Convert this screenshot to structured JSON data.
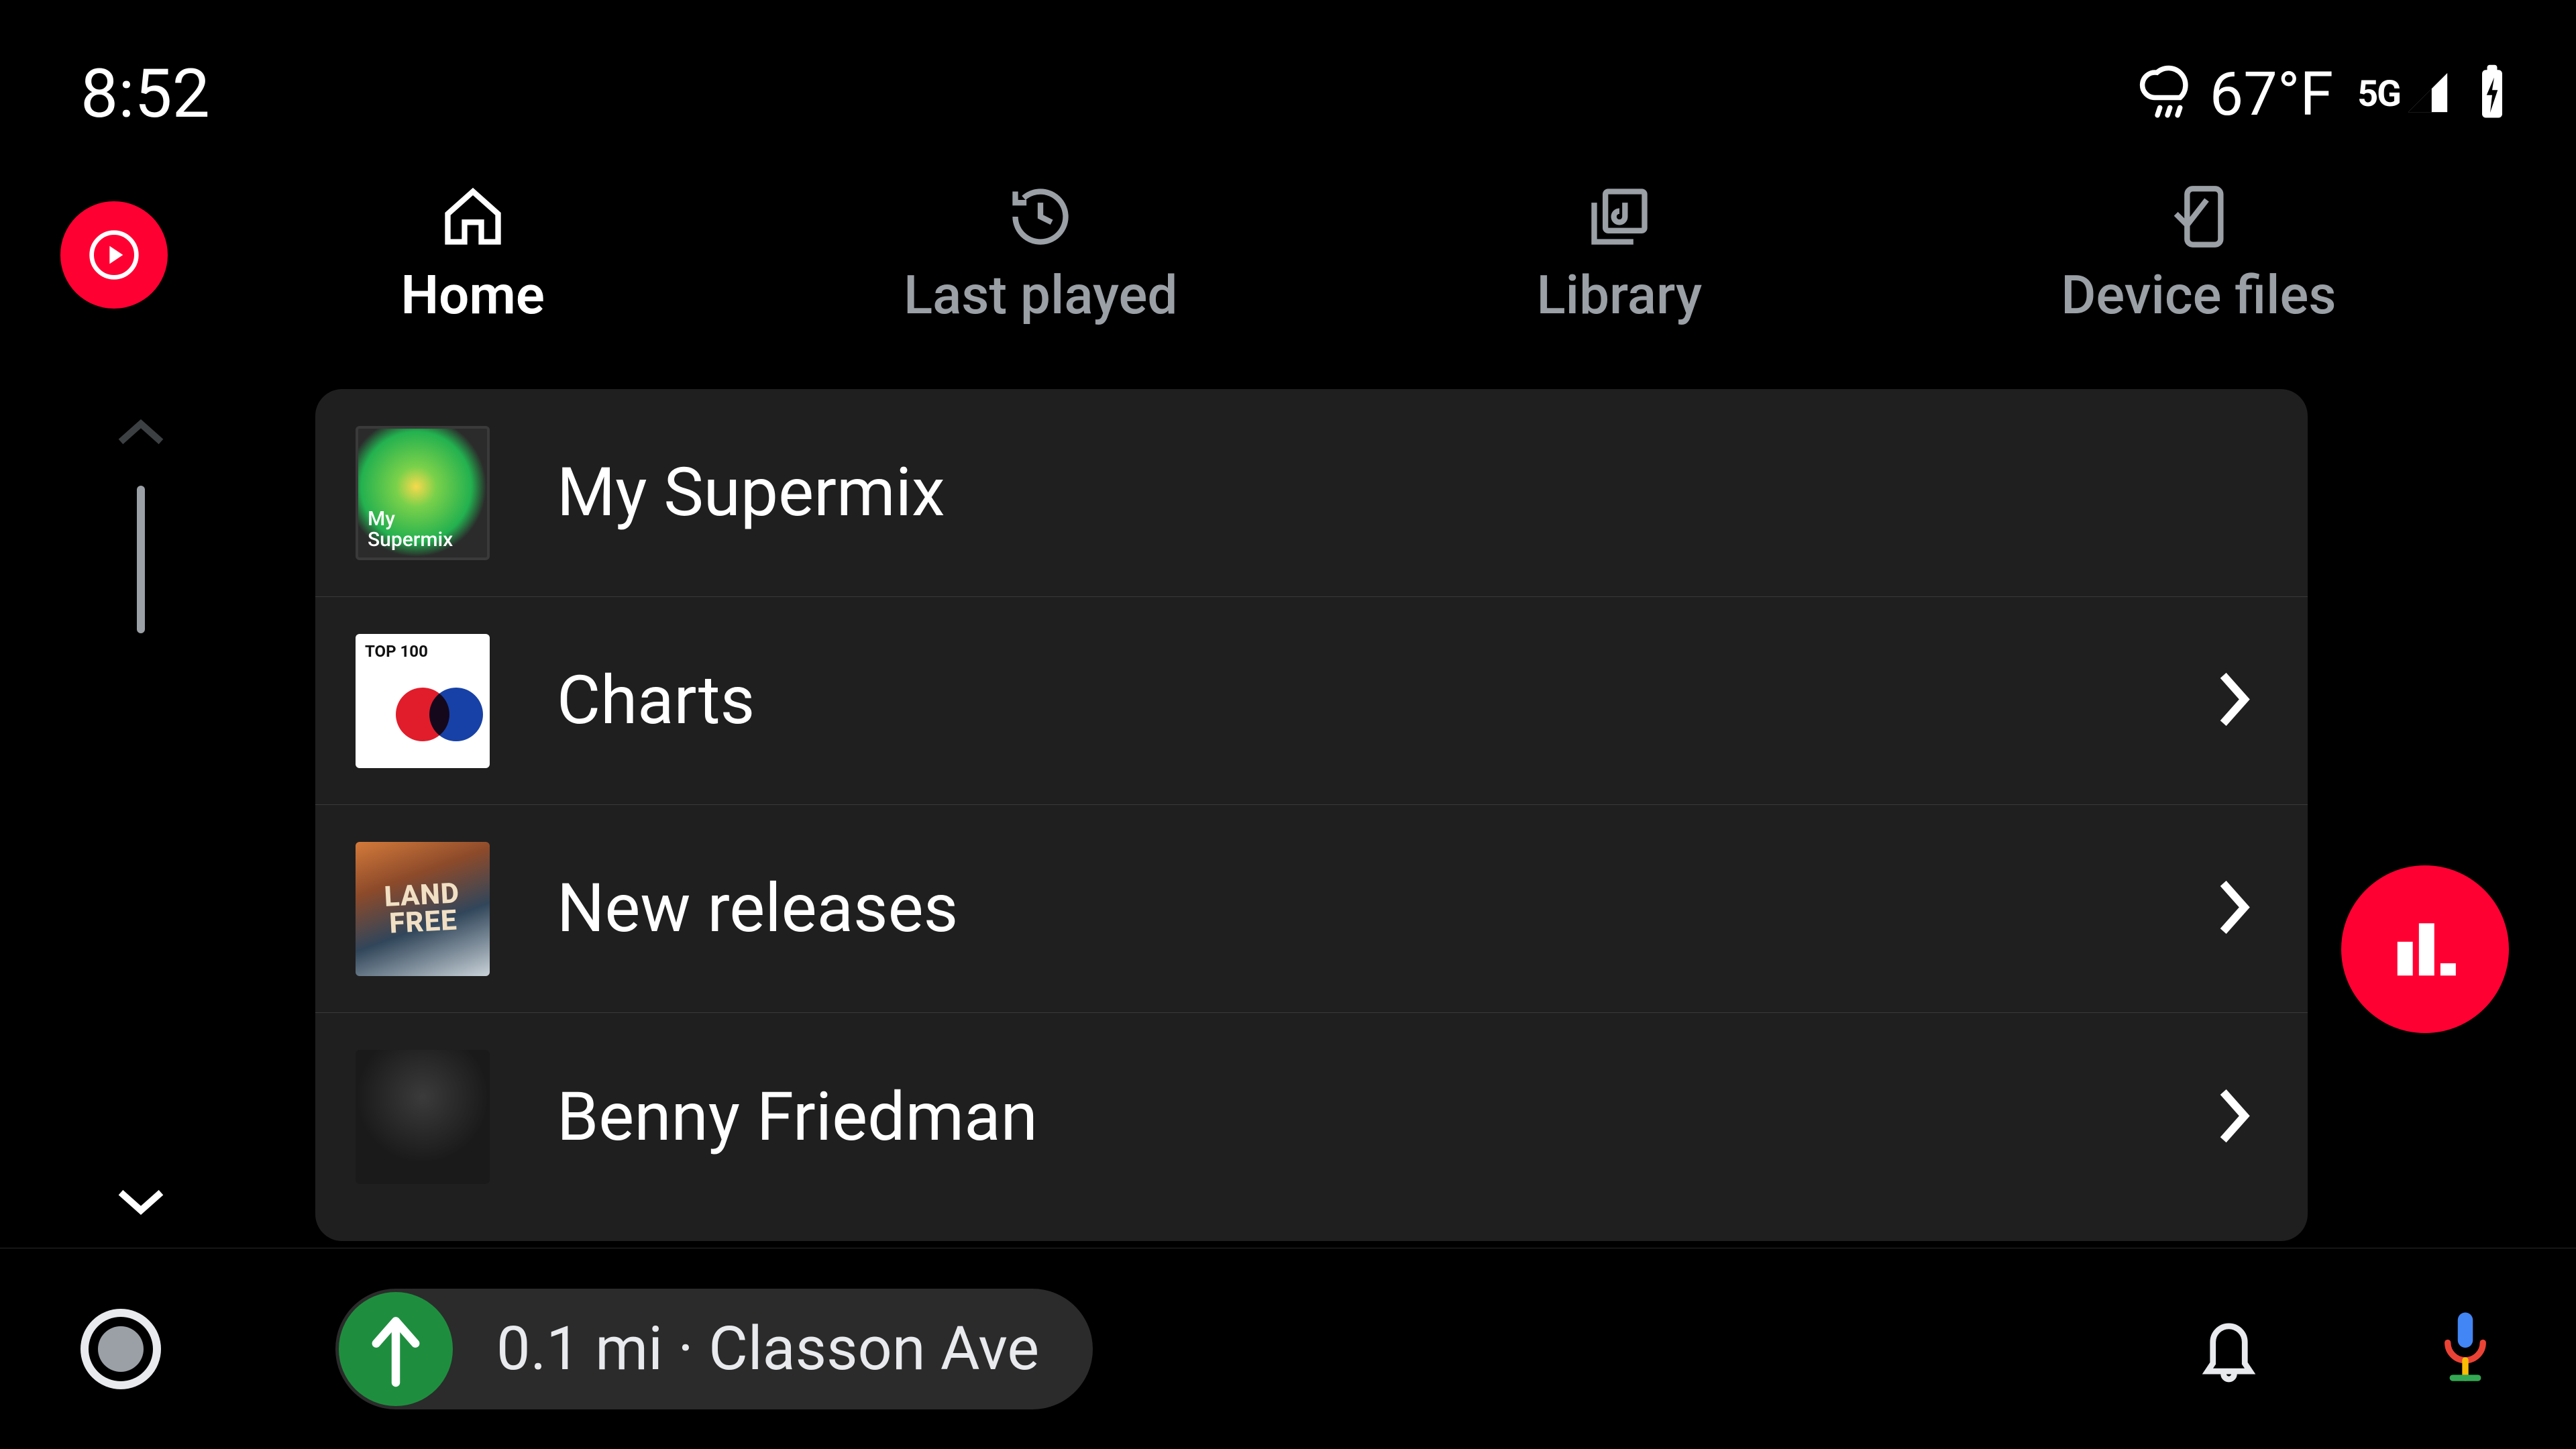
{
  "status": {
    "time": "8:52",
    "weather_temp": "67°F",
    "network_label": "5G"
  },
  "app": {
    "name": "youtube-music"
  },
  "tabs": [
    {
      "id": "home",
      "label": "Home",
      "icon": "home-icon",
      "active": true
    },
    {
      "id": "last-played",
      "label": "Last played",
      "icon": "history-icon",
      "active": false
    },
    {
      "id": "library",
      "label": "Library",
      "icon": "library-icon",
      "active": false
    },
    {
      "id": "device-files",
      "label": "Device files",
      "icon": "device-files-icon",
      "active": false
    }
  ],
  "list": [
    {
      "label": "My Supermix",
      "has_chevron": false,
      "thumb": "supermix",
      "thumb_overlay": "My\nSupermix"
    },
    {
      "label": "Charts",
      "has_chevron": true,
      "thumb": "charts",
      "thumb_overlay": "TOP 100"
    },
    {
      "label": "New releases",
      "has_chevron": true,
      "thumb": "newrel",
      "thumb_overlay": "LAND\nFREE"
    },
    {
      "label": "Benny Friedman",
      "has_chevron": true,
      "thumb": "artist",
      "thumb_overlay": ""
    }
  ],
  "nav": {
    "distance": "0.1 mi",
    "separator": "·",
    "street": "Classon Ave"
  }
}
